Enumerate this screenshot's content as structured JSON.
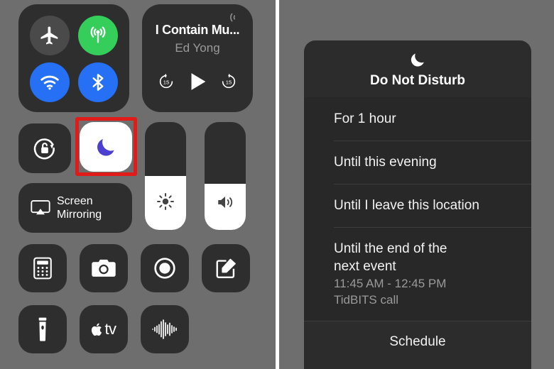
{
  "colors": {
    "background": "#6e6e6e",
    "tile": "#2e2e2e",
    "toggle_off": "#4a4a4a",
    "cellular_green": "#35ce5b",
    "wifi_blue": "#2570f4",
    "moon_indigo": "#4b3fd0",
    "highlight_red": "#e01b18",
    "dialog": "#2c2c2c",
    "dialog_rows": "#282828"
  },
  "left_panel": {
    "connectivity": {
      "toggles": [
        {
          "name": "airplane-mode-toggle",
          "icon": "airplane-icon",
          "state": "off"
        },
        {
          "name": "cellular-data-toggle",
          "icon": "cellular-icon",
          "state": "on"
        },
        {
          "name": "wifi-toggle",
          "icon": "wifi-icon",
          "state": "on"
        },
        {
          "name": "bluetooth-toggle",
          "icon": "bluetooth-icon",
          "state": "on"
        }
      ]
    },
    "media": {
      "title": "I Contain Mu...",
      "artist": "Ed Yong",
      "airplay_icon": "airplay-icon",
      "controls": [
        {
          "name": "skip-back-15-button",
          "icon": "skip-back-15-icon",
          "label": "15"
        },
        {
          "name": "play-button",
          "icon": "play-icon"
        },
        {
          "name": "skip-forward-15-button",
          "icon": "skip-forward-15-icon",
          "label": "15"
        }
      ]
    },
    "rotation_lock": {
      "icon": "rotation-lock-icon",
      "state": "off"
    },
    "do_not_disturb": {
      "icon": "moon-icon",
      "state": "on",
      "highlighted": true
    },
    "screen_mirroring": {
      "icon": "screen-mirroring-icon",
      "label_line1": "Screen",
      "label_line2": "Mirroring"
    },
    "sliders": [
      {
        "name": "brightness-slider",
        "icon": "brightness-icon",
        "value_percent": 50
      },
      {
        "name": "volume-slider",
        "icon": "volume-icon",
        "value_percent": 43
      }
    ],
    "apps": [
      {
        "name": "calculator-button",
        "icon": "calculator-icon"
      },
      {
        "name": "camera-button",
        "icon": "camera-icon"
      },
      {
        "name": "screen-record-button",
        "icon": "screen-record-icon"
      },
      {
        "name": "notes-button",
        "icon": "notes-icon"
      },
      {
        "name": "flashlight-button",
        "icon": "flashlight-icon"
      },
      {
        "name": "apple-tv-remote-button",
        "icon": "apple-tv-icon"
      },
      {
        "name": "voice-memos-button",
        "icon": "voice-memos-icon"
      }
    ]
  },
  "right_panel": {
    "dialog": {
      "icon": "moon-icon",
      "title": "Do Not Disturb",
      "options": [
        {
          "label": "For 1 hour",
          "sub1": "",
          "sub2": ""
        },
        {
          "label": "Until this evening",
          "sub1": "",
          "sub2": ""
        },
        {
          "label": "Until I leave this location",
          "sub1": "",
          "sub2": ""
        },
        {
          "label": "Until the end of the next event",
          "sub1": "11:45 AM - 12:45 PM",
          "sub2": "TidBITS call"
        }
      ],
      "footer_label": "Schedule"
    }
  }
}
